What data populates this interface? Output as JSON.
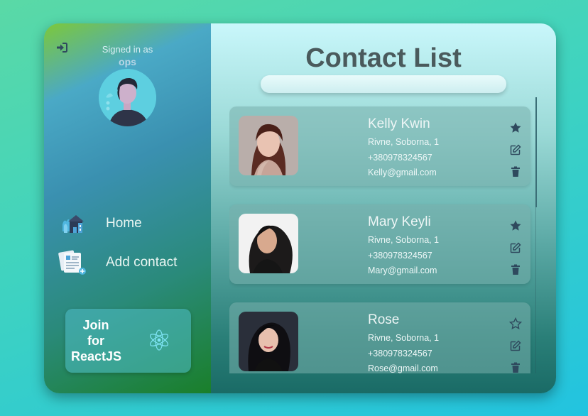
{
  "sidebar": {
    "signed_label": "Signed in as",
    "user_name": "ops",
    "nav": [
      {
        "label": "Home",
        "icon": "home-icon"
      },
      {
        "label": "Add contact",
        "icon": "add-contact-icon"
      }
    ],
    "join": {
      "line1": "Join",
      "line2": "for",
      "line3": "ReactJS",
      "icon": "react-icon"
    }
  },
  "main": {
    "title": "Contact List",
    "search_placeholder": "",
    "contacts": [
      {
        "name": "Kelly Kwin",
        "address": "Rivne, Soborna, 1",
        "phone": "+380978324567",
        "email": "Kelly@gmail.com",
        "favorite": true
      },
      {
        "name": "Mary Keyli",
        "address": "Rivne, Soborna, 1",
        "phone": "+380978324567",
        "email": "Mary@gmail.com",
        "favorite": true
      },
      {
        "name": "Rose",
        "address": "Rivne, Soborna, 1",
        "phone": "+380978324567",
        "email": "Rose@gmail.com",
        "favorite": false
      }
    ]
  },
  "colors": {
    "icon_dark": "#2f4a5e",
    "title": "#4a5a5c",
    "card_text": "#eef6f6"
  }
}
